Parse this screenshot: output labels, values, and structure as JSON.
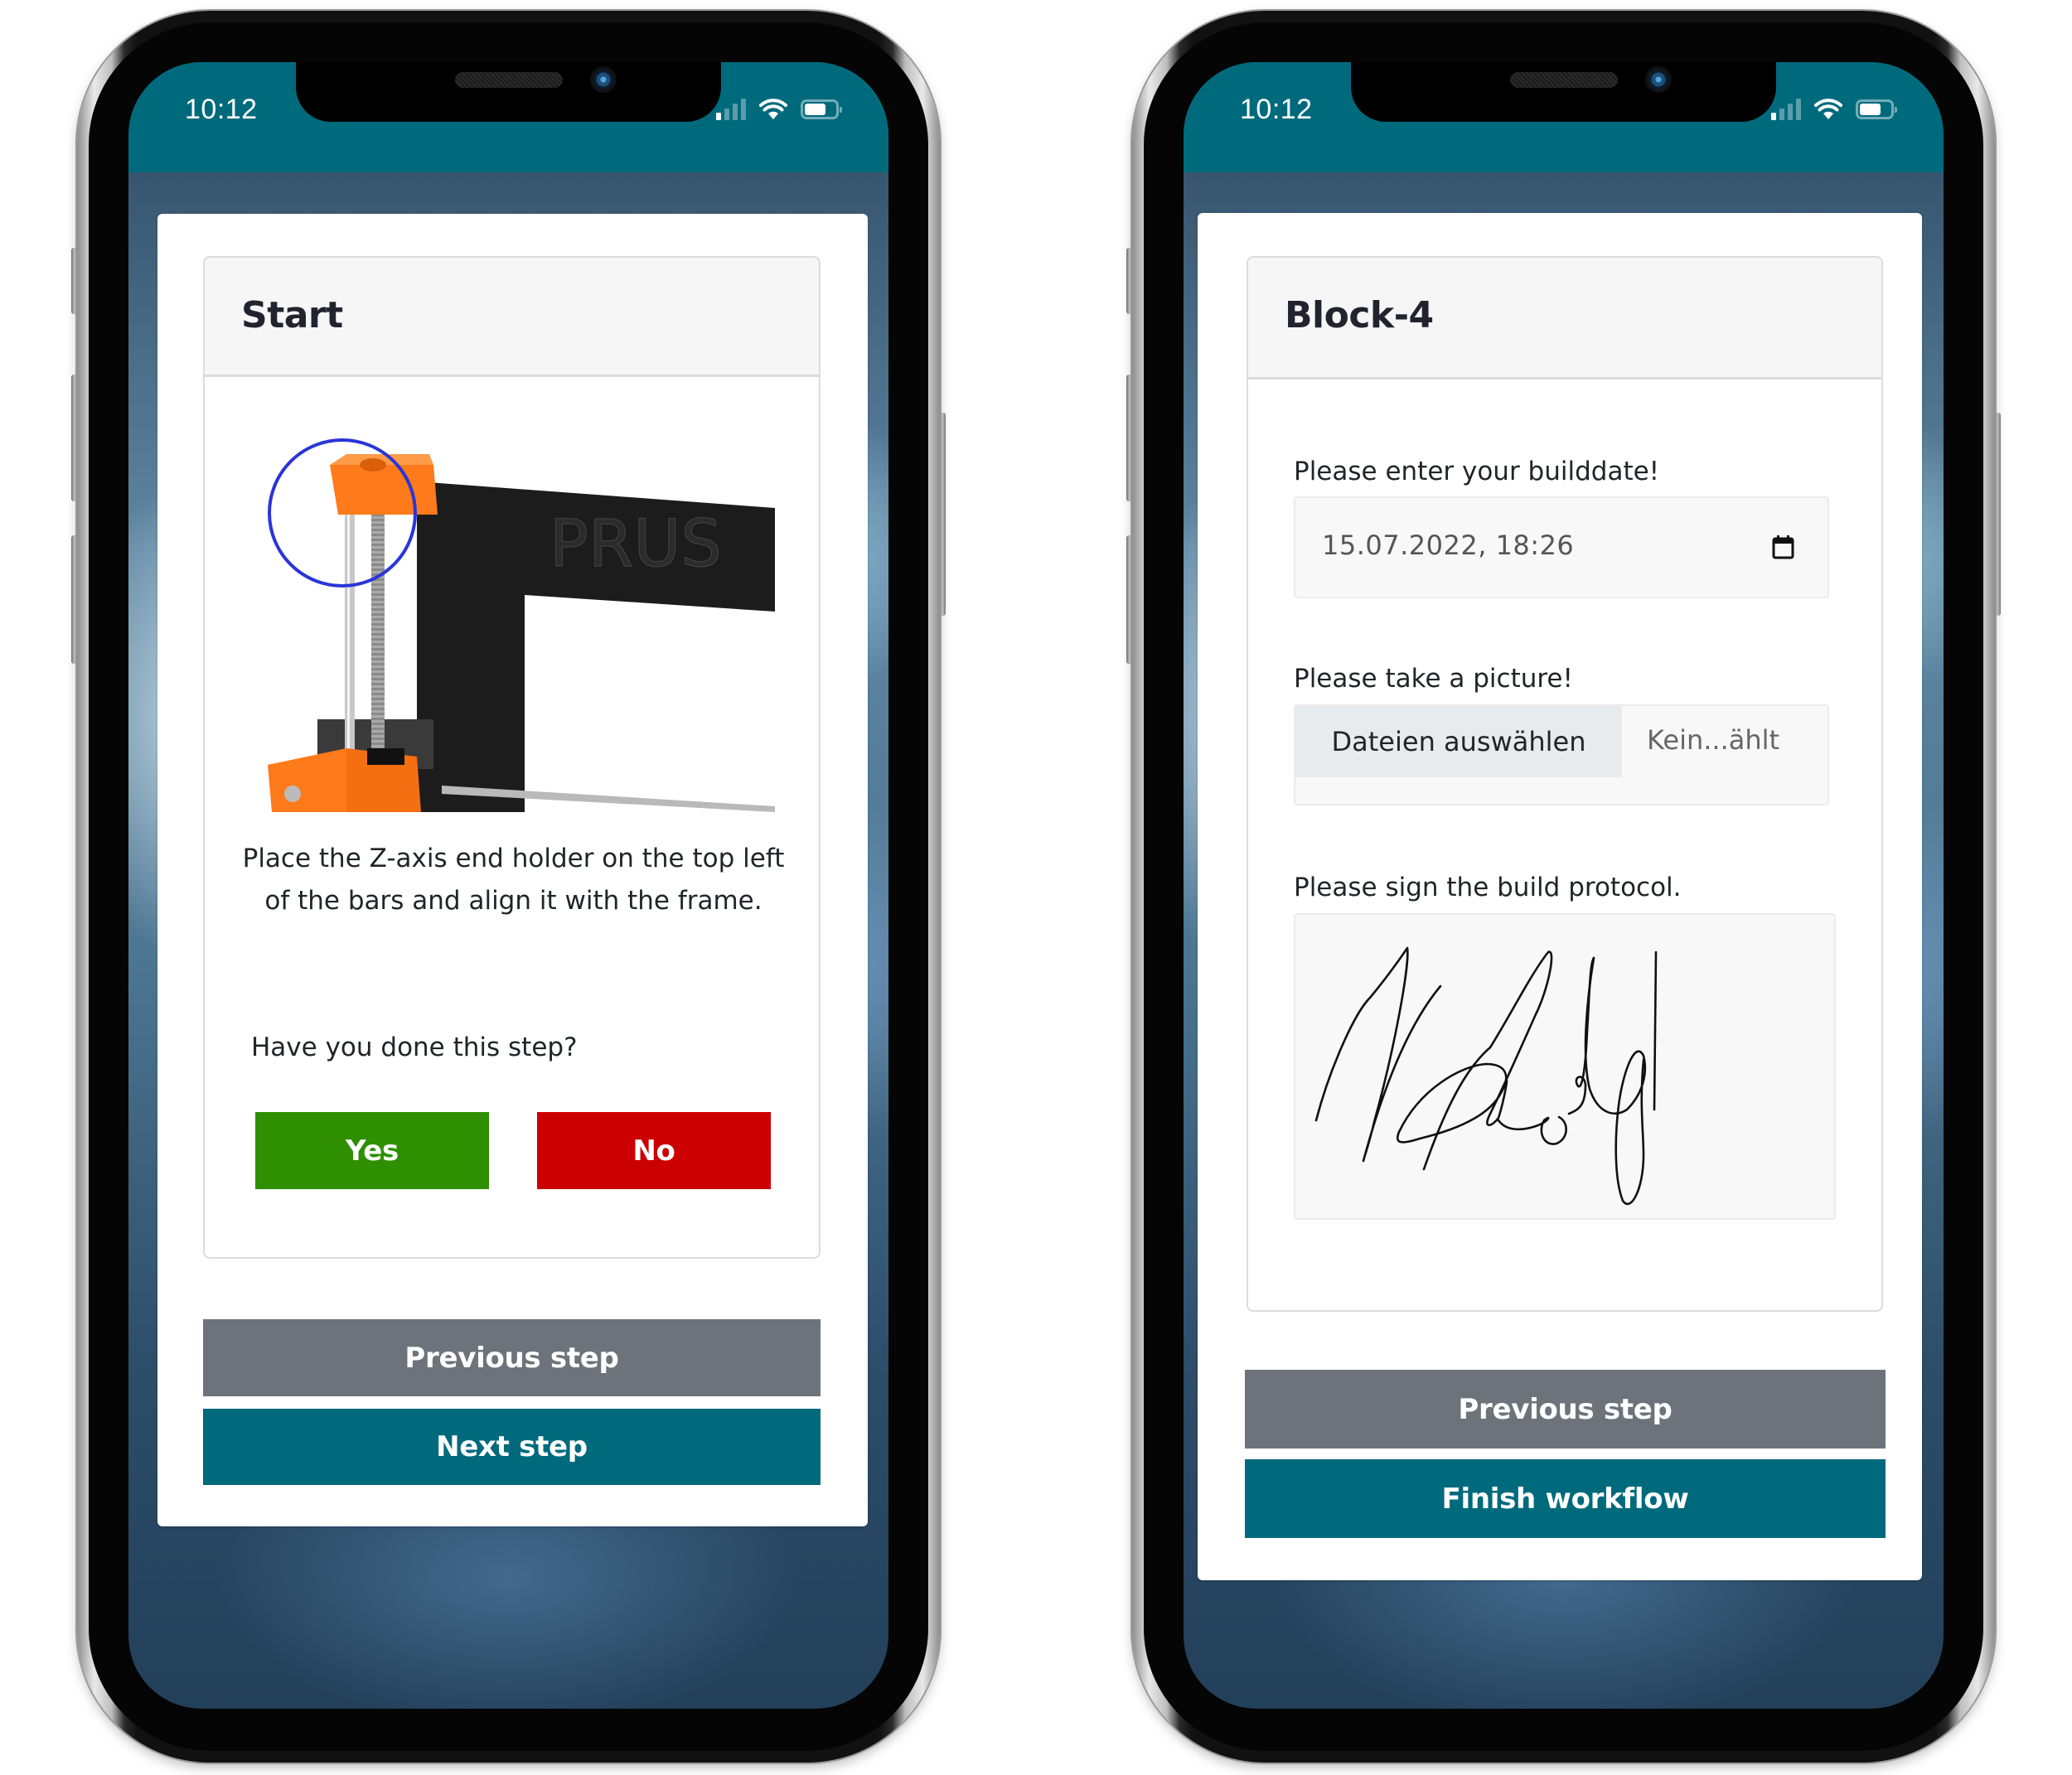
{
  "status_bar": {
    "time": "10:12",
    "signal_bars_active": 1,
    "signal_bars_total": 4,
    "wifi_icon": "wifi-icon",
    "battery_icon": "battery-icon"
  },
  "colors": {
    "brand_teal": "#006a7d",
    "secondary_gray": "#6c737b",
    "yes_green": "#2e8f00",
    "no_red": "#cc0000"
  },
  "screens": [
    {
      "card_title": "Start",
      "image_alt": "Prusa Z-axis end holder placement photo",
      "image_text": "PRUS",
      "description": "Place the Z-axis end holder on the top left of the bars and align it with the frame.",
      "question": "Have you done this step?",
      "yes_label": "Yes",
      "no_label": "No",
      "previous_label": "Previous step",
      "next_label": "Next step"
    },
    {
      "card_title": "Block-4",
      "date_label": "Please enter your builddate!",
      "date_value": "15.07.2022, 18:26",
      "picture_label": "Please take a picture!",
      "file_button_label": "Dateien auswählen",
      "file_status": "Kein...ählt",
      "signature_label": "Please sign the build protocol.",
      "previous_label": "Previous step",
      "finish_label": "Finish workflow"
    }
  ]
}
